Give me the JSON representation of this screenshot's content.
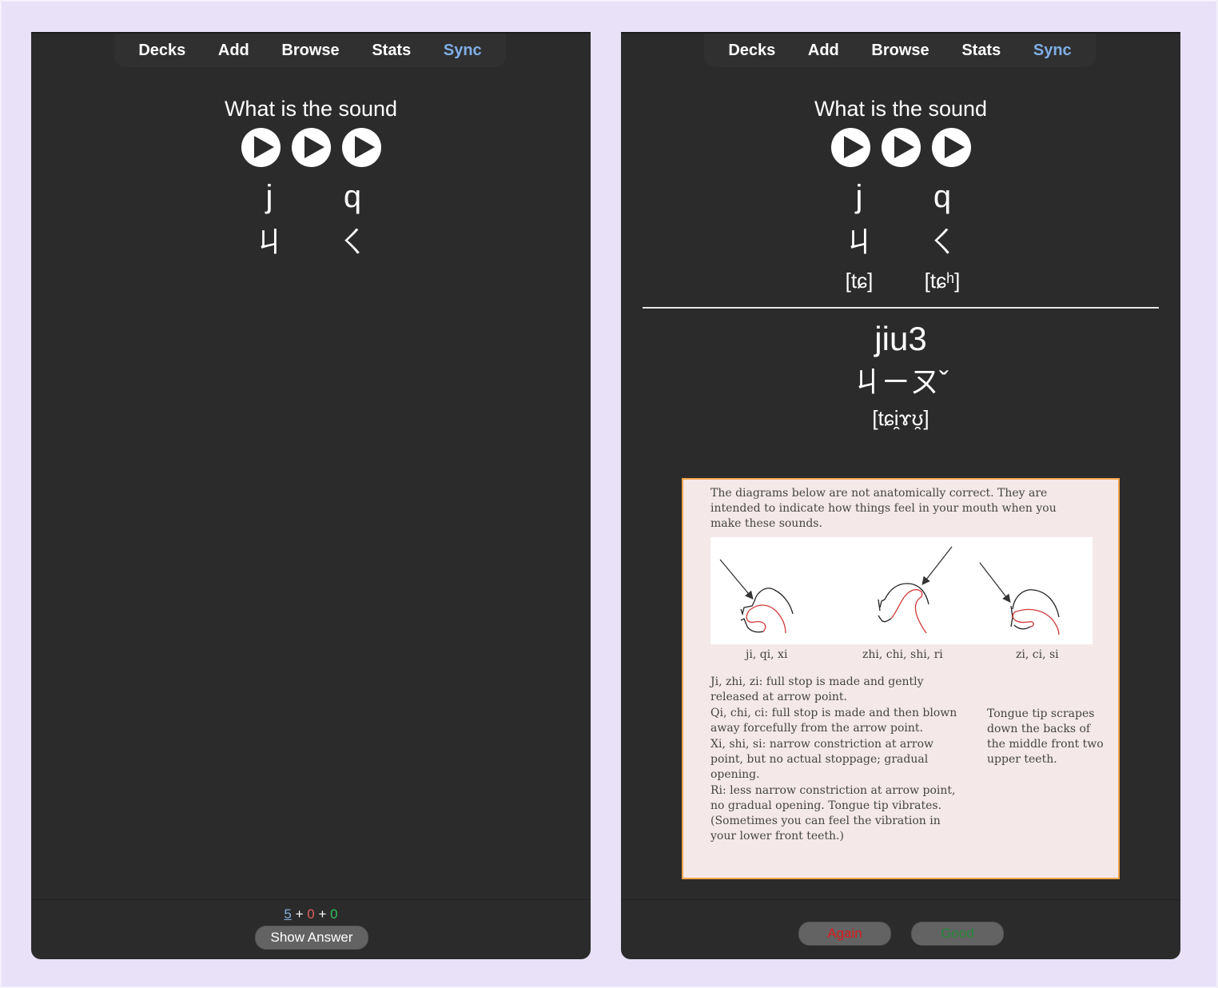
{
  "nav": {
    "items": [
      "Decks",
      "Add",
      "Browse",
      "Stats",
      "Sync"
    ],
    "active_color": "#80aee6"
  },
  "front_card": {
    "prompt": "What is the sound",
    "audio_buttons": [
      "play-icon",
      "play-icon",
      "play-icon"
    ],
    "pinyin": [
      "j",
      "q"
    ],
    "zhuyin": [
      "ㄐ",
      "ㄑ"
    ]
  },
  "back_card": {
    "prompt": "What is the sound",
    "audio_buttons": [
      "play-icon",
      "play-icon",
      "play-icon"
    ],
    "pinyin": [
      "j",
      "q"
    ],
    "zhuyin": [
      "ㄐ",
      "ㄑ"
    ],
    "ipa": [
      "[tɕ]",
      "[tɕʰ]"
    ],
    "answer": {
      "pinyin": "jiu3",
      "zhuyin": "ㄐㄧㄡˇ",
      "ipa": "[tɕi̯ɤʊ̯]"
    },
    "notes": {
      "intro": "The diagrams below are not anatomically correct. They are intended to indicate how things feel in your mouth when you make these sounds.",
      "diagram_labels": [
        "ji, qi, xi",
        "zhi, chi, shi, ri",
        "zi, ci, si"
      ],
      "descriptions": [
        "Ji, zhi, zi: full stop is made and gently released at arrow point.",
        "Qi, chi, ci: full stop is made and then blown away forcefully from the arrow point.",
        "Xi, shi, si: narrow constriction at arrow point, but no actual stoppage; gradual opening.",
        "Ri: less narrow constriction at arrow point, no gradual opening. Tongue tip vibrates. (Sometimes you can feel the vibration in your lower front teeth.)"
      ],
      "side_note": "Tongue tip scrapes down the backs of the middle front two upper teeth."
    }
  },
  "front_bottom": {
    "counts": {
      "new": "5",
      "learning": "0",
      "review": "0",
      "separator": "+"
    },
    "show_answer_label": "Show Answer"
  },
  "back_bottom": {
    "again_label": "Again",
    "good_label": "Good"
  },
  "colors": {
    "new": "#86aee0",
    "learning": "#e06060",
    "review": "#30c060",
    "again": "#d81c1c",
    "good": "#23883a",
    "note_border": "#f0a54a",
    "note_bg": "#f5e8e8"
  }
}
